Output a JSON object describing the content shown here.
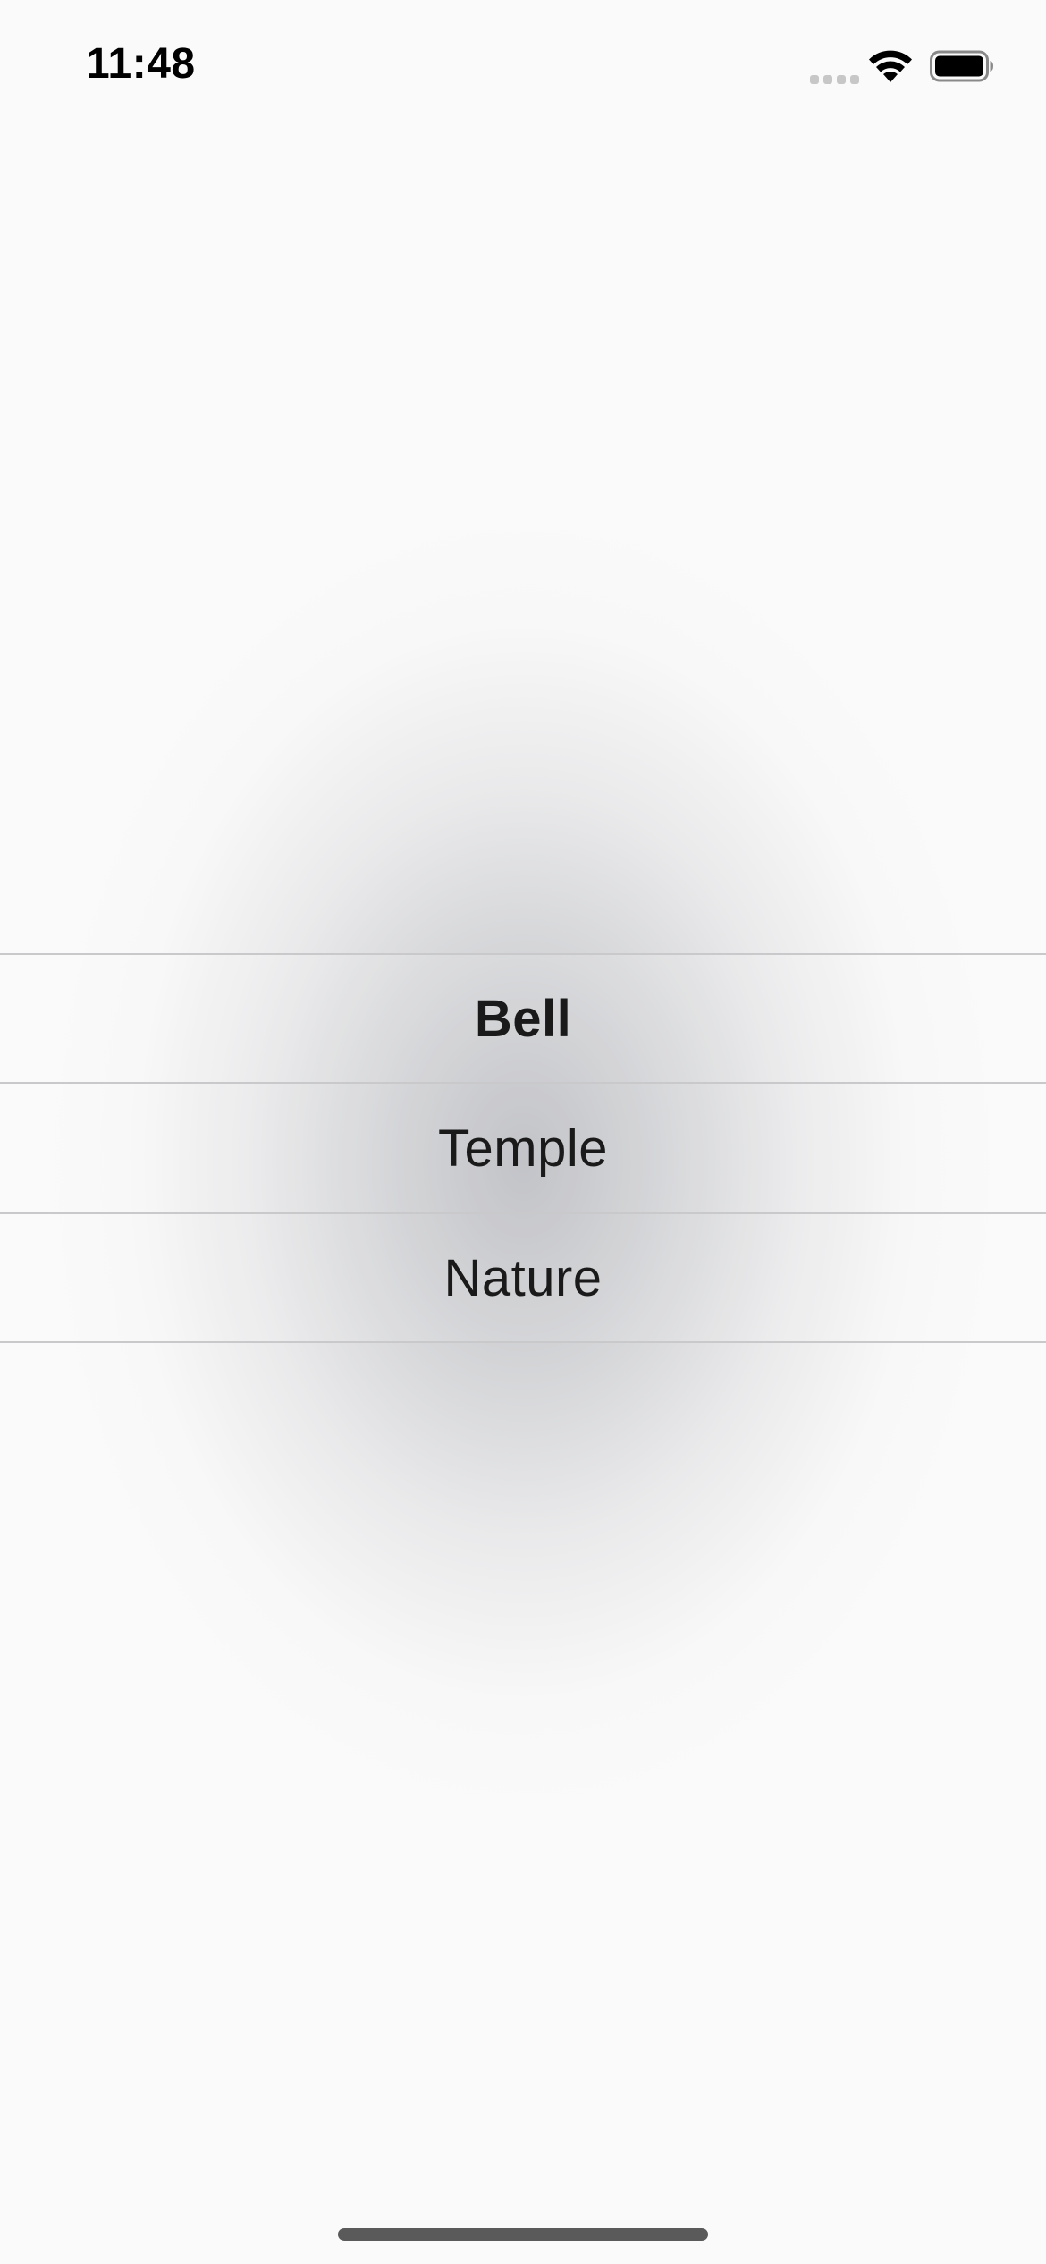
{
  "status_bar": {
    "time": "11:48",
    "signal_icon": "cellular-signal-icon",
    "wifi_icon": "wifi-icon",
    "battery_icon": "battery-icon"
  },
  "picker": {
    "options": [
      {
        "label": "Bell",
        "selected": true
      },
      {
        "label": "Temple",
        "selected": false
      },
      {
        "label": "Nature",
        "selected": false
      }
    ]
  },
  "colors": {
    "text": "#1a1a1a",
    "separator": "#c9c9cc",
    "background": "#fafafa"
  }
}
